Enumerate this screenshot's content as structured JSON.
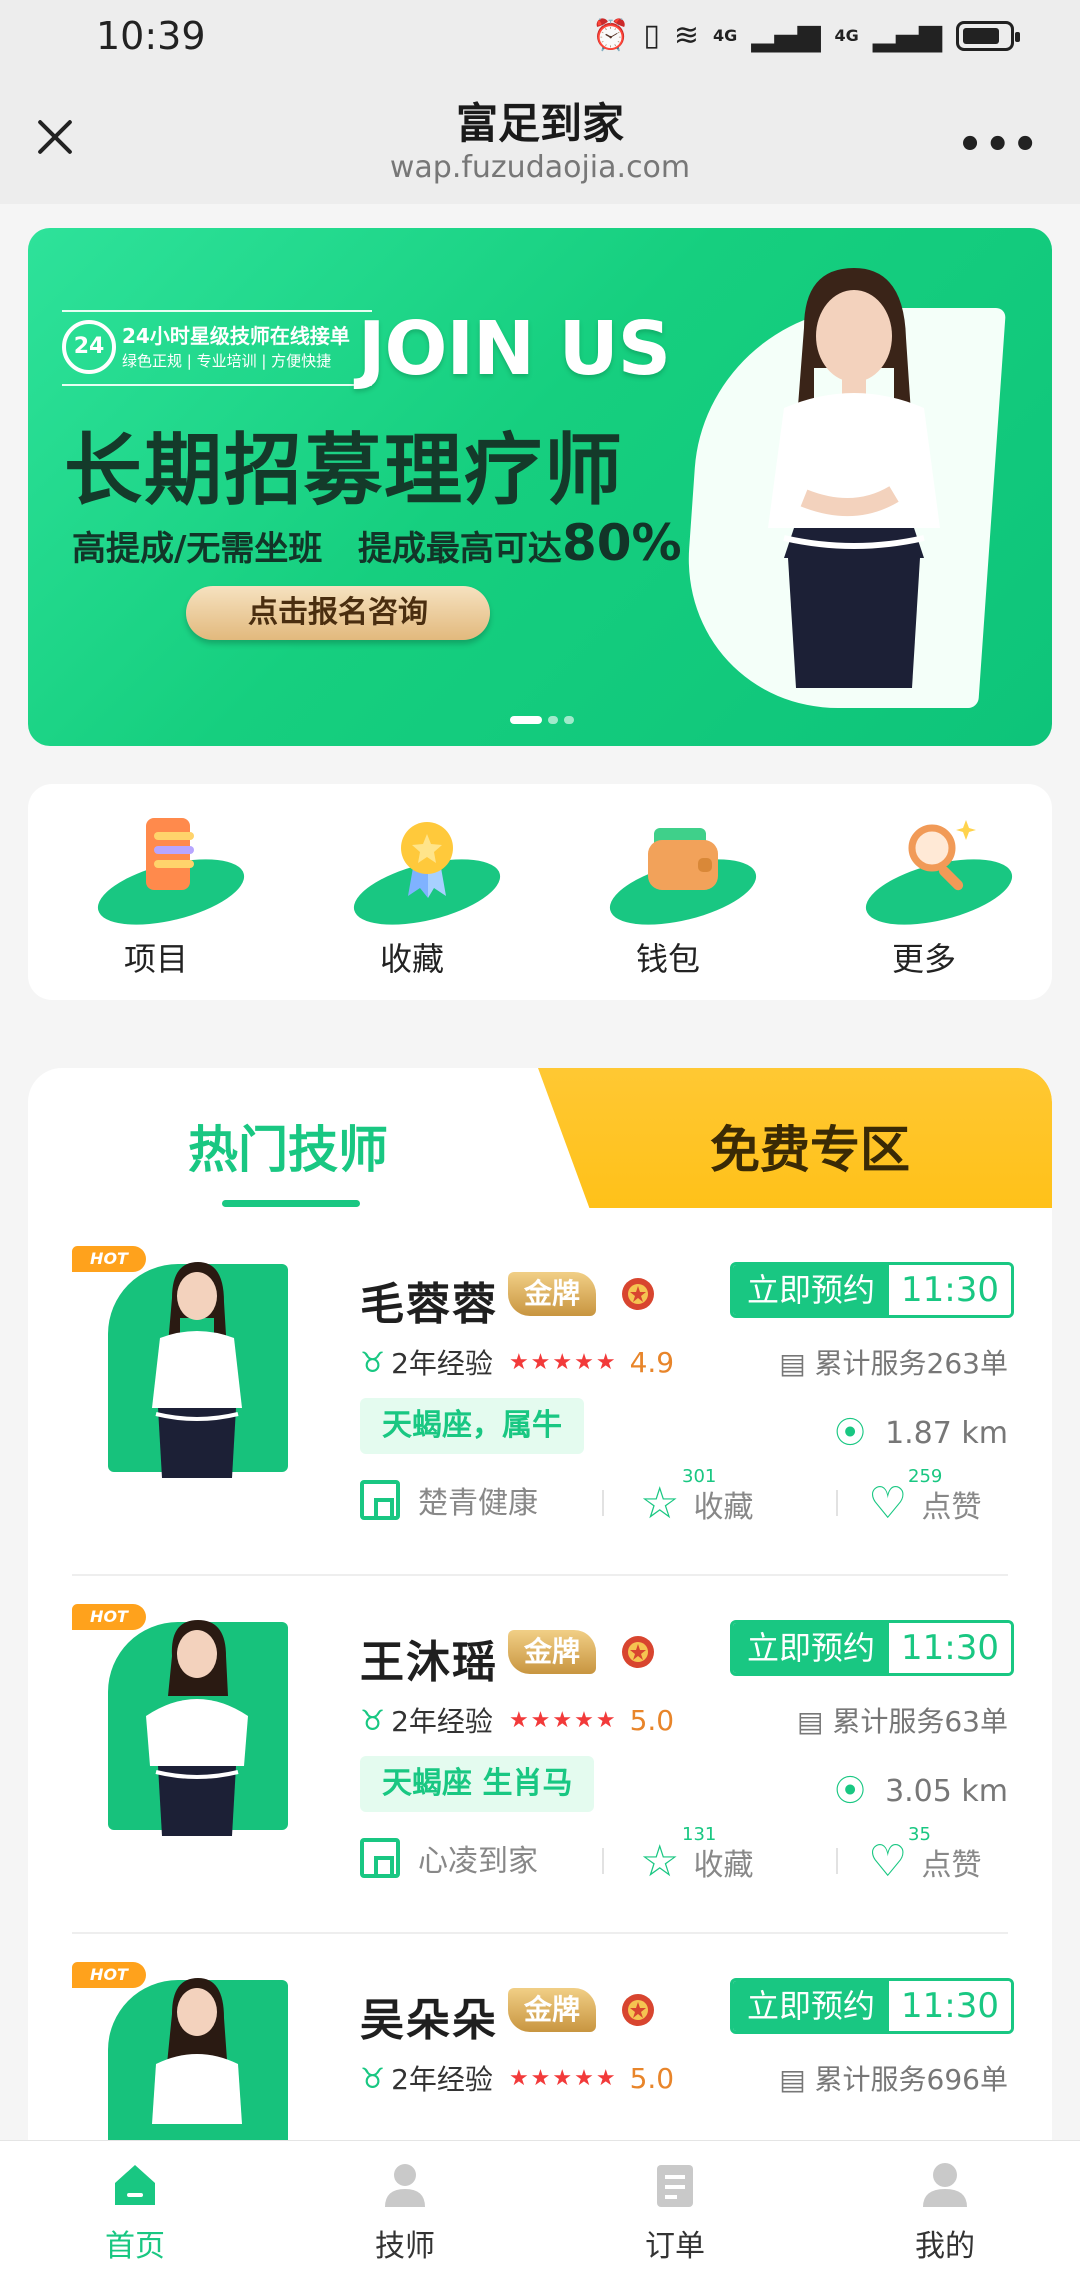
{
  "status_bar": {
    "time": "10:39",
    "net1": "4G",
    "net2": "4G"
  },
  "nav": {
    "title": "富足到家",
    "url": "wap.fuzudaojia.com"
  },
  "banner": {
    "badge_line1": "24小时星级技师在线接单",
    "badge_line2": "绿色正规 | 专业培训 | 方便快捷",
    "badge_icon_text": "24",
    "join": "JOIN US",
    "headline": "长期招募理疗师",
    "sub_left": "高提成/无需坐班",
    "sub_mid": "提成最高可达",
    "sub_pct": "80%",
    "cta": "点击报名咨询"
  },
  "quick_menu": [
    {
      "label": "项目",
      "icon": "list-icon"
    },
    {
      "label": "收藏",
      "icon": "medal-icon"
    },
    {
      "label": "钱包",
      "icon": "wallet-icon"
    },
    {
      "label": "更多",
      "icon": "magnifier-icon"
    }
  ],
  "tabs": {
    "hot": "热门技师",
    "free": "免费专区"
  },
  "badge_gold": "金牌",
  "hot_tag": "HOT",
  "book_label": "立即预约",
  "fav_label": "收藏",
  "like_label": "点赞",
  "therapists": [
    {
      "name": "毛蓉蓉",
      "time": "11:30",
      "exp": "2年经验",
      "stars": "★★★★★",
      "score": "4.9",
      "served": "累计服务263单",
      "tag": "天蝎座，属牛",
      "distance": "1.87 km",
      "shop": "楚青健康",
      "fav_count": "301",
      "like_count": "259"
    },
    {
      "name": "王沐瑶",
      "time": "11:30",
      "exp": "2年经验",
      "stars": "★★★★★",
      "score": "5.0",
      "served": "累计服务63单",
      "tag": "天蝎座 生肖马",
      "distance": "3.05 km",
      "shop": "心凌到家",
      "fav_count": "131",
      "like_count": "35"
    },
    {
      "name": "吴朵朵",
      "time": "11:30",
      "exp": "2年经验",
      "stars": "★★★★★",
      "score": "5.0",
      "served": "累计服务696单"
    }
  ],
  "tabbar": [
    {
      "label": "首页",
      "icon": "home-icon",
      "active": true
    },
    {
      "label": "技师",
      "icon": "person-icon",
      "active": false
    },
    {
      "label": "订单",
      "icon": "order-icon",
      "active": false
    },
    {
      "label": "我的",
      "icon": "profile-icon",
      "active": false
    }
  ],
  "colors": {
    "accent": "#19c782",
    "gold": "#ffc119",
    "hot": "#ffa21c",
    "star": "#f23a3a"
  }
}
